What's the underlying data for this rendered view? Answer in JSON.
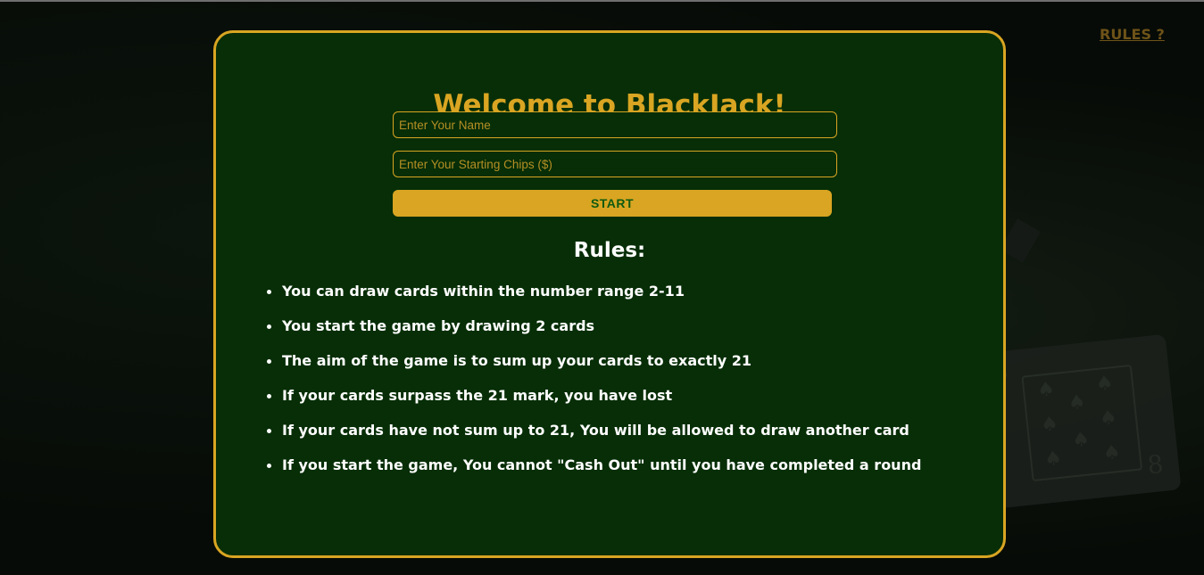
{
  "nav": {
    "rules_link": "RULES ?"
  },
  "modal": {
    "title": "Welcome to BlackJack!",
    "name_placeholder": "Enter Your Name",
    "chips_placeholder": "Enter Your Starting Chips ($)",
    "start_label": "START",
    "rules_title": "Rules:",
    "rules": [
      "You can draw cards within the number range 2-11",
      "You start the game by drawing 2 cards",
      "The aim of the game is to sum up your cards to exactly 21",
      "If your cards surpass the 21 mark, you have lost",
      "If your cards have not sum up to 21, You will be allowed to draw another card",
      "If you start the game, You cannot \"Cash Out\" until you have completed a round"
    ]
  },
  "colors": {
    "accent": "#d9a522",
    "panel": "#072e07",
    "button_text": "#0e5a10"
  },
  "background": {
    "card_icon": "playing-card-eight-of-spades"
  }
}
